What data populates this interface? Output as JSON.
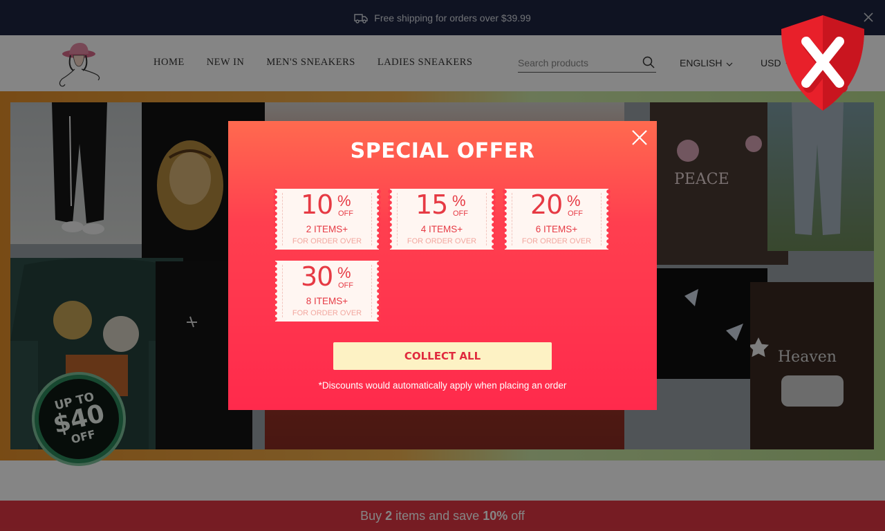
{
  "announcement": {
    "text": "Free shipping for orders over $39.99"
  },
  "header": {
    "nav": [
      "HOME",
      "NEW IN",
      "MEN'S SNEAKERS",
      "LADIES SNEAKERS"
    ],
    "search": {
      "placeholder": "Search products"
    },
    "language": "ENGLISH",
    "currency": "USD"
  },
  "hero": {
    "badge": {
      "line1": "UP TO",
      "line2": "$40",
      "line3": "OFF"
    }
  },
  "bottom_bar": {
    "prefix": "Buy",
    "count": "2",
    "middle": "items and save",
    "discount": "10%",
    "suffix": "off"
  },
  "modal": {
    "title": "SPECIAL OFFER",
    "percent_sign": "%",
    "off_label": "OFF",
    "for_label": "FOR ORDER OVER",
    "coupons": [
      {
        "value": "10",
        "items": "2 ITEMS+"
      },
      {
        "value": "15",
        "items": "4 ITEMS+"
      },
      {
        "value": "20",
        "items": "6 ITEMS+"
      },
      {
        "value": "30",
        "items": "8 ITEMS+"
      }
    ],
    "collect_label": "COLLECT ALL",
    "disclaimer": "*Discounts would automatically apply when placing an order"
  },
  "shield": {
    "letter": "X"
  },
  "colors": {
    "announce_bg": "#1d2642",
    "modal_top": "#ff6a4f",
    "modal_bottom": "#ff2a4c",
    "coupon_text": "#e63a44",
    "collect_bg": "#fdf2c4",
    "bottom_bar": "#e23744",
    "shield_red": "#e8202a"
  },
  "icons": [
    "truck-icon",
    "close-icon",
    "logo-icon",
    "search-icon",
    "chevron-down-icon",
    "shield-icon"
  ]
}
